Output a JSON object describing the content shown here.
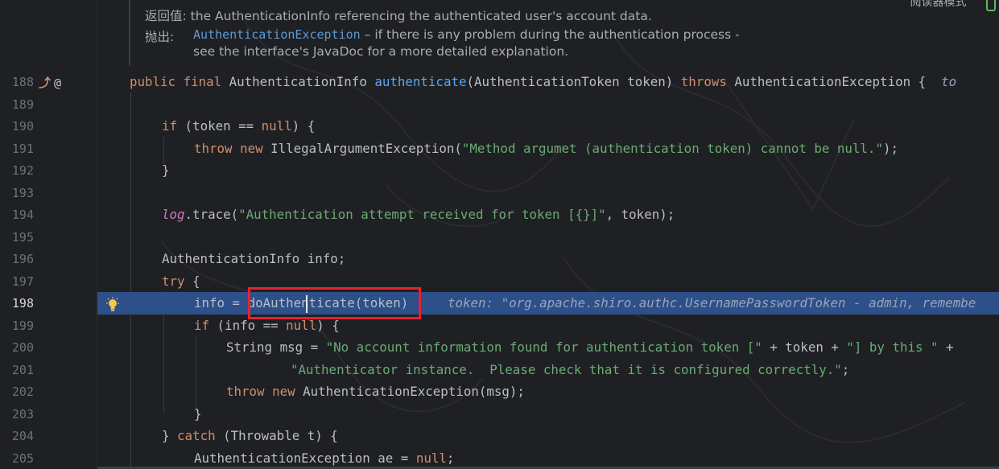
{
  "doc": {
    "returns_label": "返回值:",
    "returns_text": "the AuthenticationInfo referencing the authenticated user's account data.",
    "throws_label": "抛出:",
    "throws_link": "AuthenticationException",
    "throws_text": "– if there is any problem during the authentication process -",
    "throws_text2": "see the interface's JavaDoc for a more detailed explanation."
  },
  "top_right_text": "阅读器模式",
  "lines": [
    {
      "num": "188"
    },
    {
      "num": "189"
    },
    {
      "num": "190"
    },
    {
      "num": "191"
    },
    {
      "num": "192"
    },
    {
      "num": "193"
    },
    {
      "num": "194"
    },
    {
      "num": "195"
    },
    {
      "num": "196"
    },
    {
      "num": "197"
    },
    {
      "num": "198"
    },
    {
      "num": "199"
    },
    {
      "num": "200"
    },
    {
      "num": "201"
    },
    {
      "num": "202"
    },
    {
      "num": "203"
    },
    {
      "num": "204"
    },
    {
      "num": "205"
    }
  ],
  "code": {
    "l188_a": "public final ",
    "l188_b": "AuthenticationInfo ",
    "l188_c": "authenticate",
    "l188_d": "(AuthenticationToken token) ",
    "l188_e": "throws ",
    "l188_f": "AuthenticationException {",
    "l188_g": "to",
    "l190_a": "if ",
    "l190_b": "(token == ",
    "l190_c": "null",
    "l190_d": ") {",
    "l191_a": "throw new ",
    "l191_b": "IllegalArgumentException(",
    "l191_c": "\"Method argumet (authentication token) cannot be null.\"",
    "l191_d": ");",
    "l192": "}",
    "l194_a": "log",
    "l194_b": ".trace(",
    "l194_c": "\"Authentication attempt received for token [{}]\"",
    "l194_d": ", token);",
    "l196": "AuthenticationInfo info;",
    "l197_a": "try ",
    "l197_b": "{",
    "l198_a": "info = doAuthenticate(token)",
    "l198_hint": "token: \"org.apache.shiro.authc.UsernamePasswordToken - admin, remembe",
    "l199_a": "if ",
    "l199_b": "(info == ",
    "l199_c": "null",
    "l199_d": ") {",
    "l200_a": "String msg = ",
    "l200_b": "\"No account information found for authentication token [\"",
    "l200_c": " + token + ",
    "l200_d": "\"] by this \"",
    "l200_e": " + ",
    "l201_a": "\"Authenticator instance.  Please check that it is configured correctly.\"",
    "l201_b": ";",
    "l202_a": "throw new ",
    "l202_b": "AuthenticationException(msg);",
    "l203": "}",
    "l204_a": "} ",
    "l204_b": "catch ",
    "l204_c": "(Throwable t) {",
    "l205_a": "AuthenticationException ae = ",
    "l205_b": "null",
    "l205_c": ";"
  },
  "colors": {
    "background": "#1f2023",
    "execution_line": "#2d4f8a",
    "highlight_box": "#e8222f",
    "keyword": "#cf8e6d",
    "string": "#6aab73",
    "function": "#56a8f5"
  },
  "icons": {
    "gutter_override": "override-icon",
    "gutter_annotation": "at-icon",
    "intention": "lightbulb-icon"
  }
}
